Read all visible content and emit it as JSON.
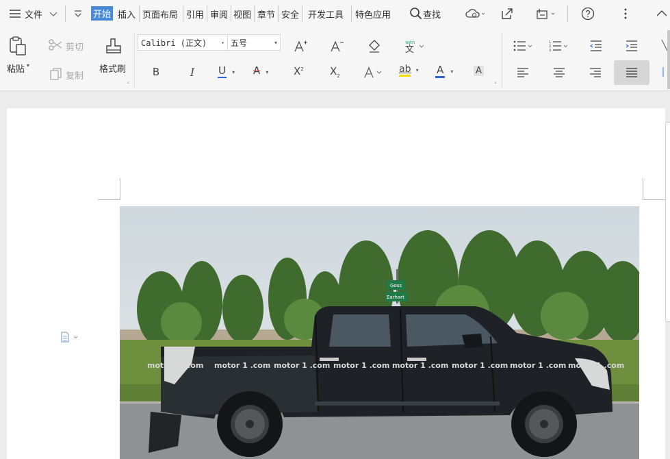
{
  "menu": {
    "file": "文件",
    "tabs": [
      "开始",
      "插入",
      "页面布局",
      "引用",
      "审阅",
      "视图",
      "章节",
      "安全",
      "开发工具",
      "特色应用"
    ],
    "active_tab_index": 0,
    "search": "查找"
  },
  "ribbon": {
    "paste": "粘贴",
    "cut": "剪切",
    "copy": "复制",
    "format_painter": "格式刷",
    "font_name": "Calibri (正文)",
    "font_size": "五号",
    "pinyin": "wén",
    "bold": "B",
    "italic": "I",
    "underline": "U",
    "strike": "A",
    "superscript": "X",
    "subscript": "X",
    "font_color_letter": "A",
    "highlight": "ab",
    "char_shading": "A"
  },
  "photo": {
    "street_sign_line1": "Goss",
    "street_sign_line2": "Earhart",
    "watermark": "motor 1 .com"
  },
  "colors": {
    "accent": "#4a8bd8",
    "underline_blue": "#2e64d8",
    "highlight_yellow": "#f3e200",
    "strike_red": "#d23c3c"
  }
}
